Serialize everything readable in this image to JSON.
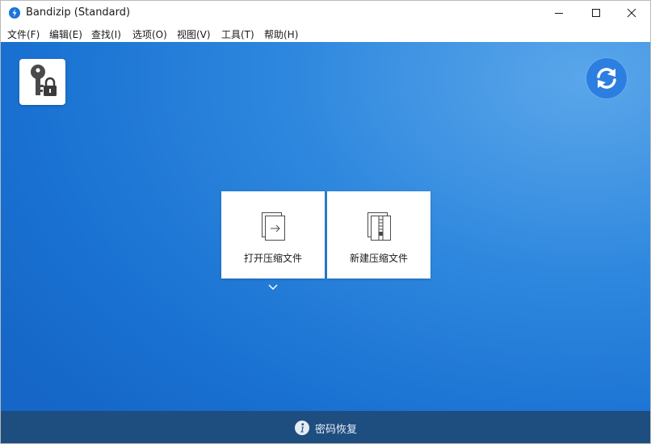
{
  "window": {
    "title": "Bandizip (Standard)"
  },
  "menu": [
    {
      "label": "文件(F)"
    },
    {
      "label": "编辑(E)"
    },
    {
      "label": "查找(I)"
    },
    {
      "label": "选项(O)"
    },
    {
      "label": "视图(V)"
    },
    {
      "label": "工具(T)"
    },
    {
      "label": "帮助(H)"
    }
  ],
  "tiles": {
    "open_label": "打开压缩文件",
    "new_label": "新建压缩文件"
  },
  "status": {
    "label": "密码恢复"
  },
  "icons": {
    "app": "bandizip-logo-icon",
    "key": "key-lock-icon",
    "refresh": "refresh-icon",
    "open": "open-file-icon",
    "new": "zip-file-icon",
    "info": "info-icon"
  },
  "colors": {
    "background_top": "#5aa6ea",
    "background_bottom": "#1566c6",
    "statusbar": "#1e4d80",
    "refresh_button": "#2c7fe0"
  }
}
